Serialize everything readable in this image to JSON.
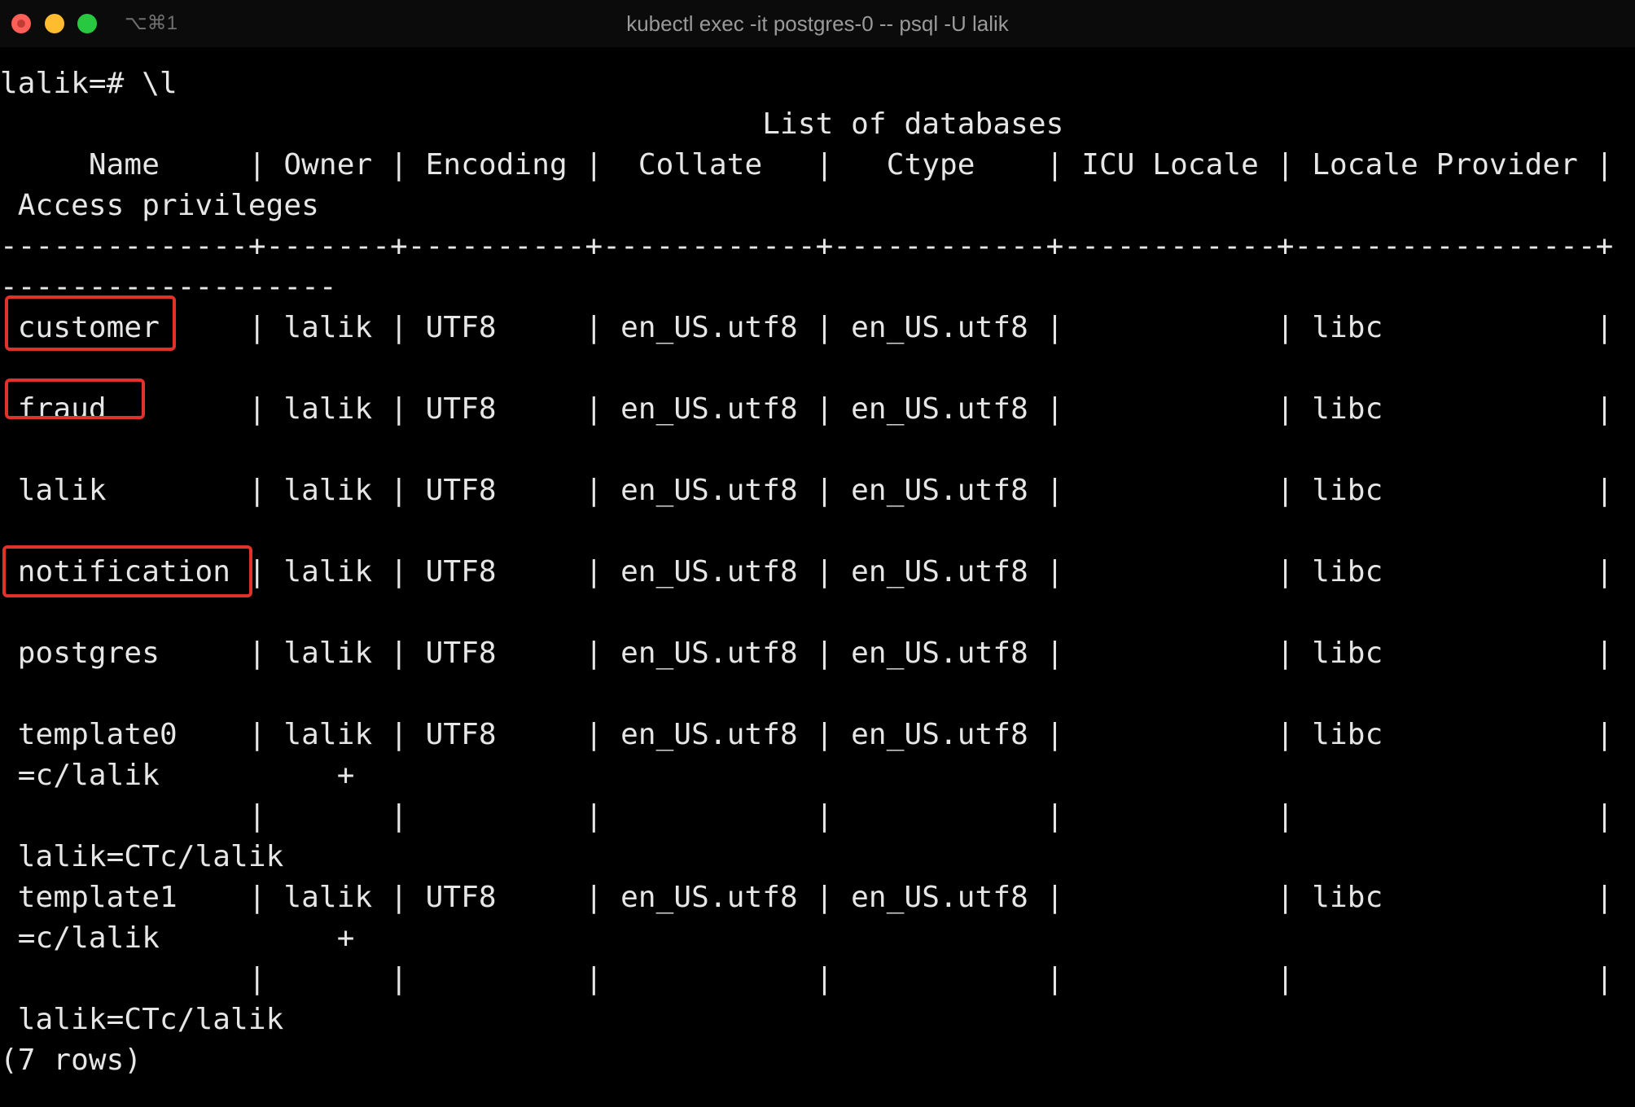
{
  "window": {
    "title": "kubectl exec -it postgres-0 -- psql -U lalik",
    "shortcut": "⌥⌘1"
  },
  "terminal": {
    "lines": [
      "lalik=# \\l",
      "                                           List of databases",
      "     Name     | Owner | Encoding |  Collate   |   Ctype    | ICU Locale | Locale Provider |",
      " Access privileges",
      "--------------+-------+----------+------------+------------+------------+-----------------+",
      "-------------------",
      " customer     | lalik | UTF8     | en_US.utf8 | en_US.utf8 |            | libc            |",
      "",
      " fraud        | lalik | UTF8     | en_US.utf8 | en_US.utf8 |            | libc            |",
      "",
      " lalik        | lalik | UTF8     | en_US.utf8 | en_US.utf8 |            | libc            |",
      "",
      " notification | lalik | UTF8     | en_US.utf8 | en_US.utf8 |            | libc            |",
      "",
      " postgres     | lalik | UTF8     | en_US.utf8 | en_US.utf8 |            | libc            |",
      "",
      " template0    | lalik | UTF8     | en_US.utf8 | en_US.utf8 |            | libc            |",
      " =c/lalik          +",
      "              |       |          |            |            |            |                 |",
      " lalik=CTc/lalik",
      " template1    | lalik | UTF8     | en_US.utf8 | en_US.utf8 |            | libc            |",
      " =c/lalik          +",
      "              |       |          |            |            |            |                 |",
      " lalik=CTc/lalik",
      "(7 rows)"
    ]
  },
  "highlights": {
    "color": "#e0322b",
    "items": [
      "customer",
      "fraud",
      "notification"
    ]
  },
  "colors": {
    "background": "#000000",
    "text": "#e6e6e6"
  }
}
